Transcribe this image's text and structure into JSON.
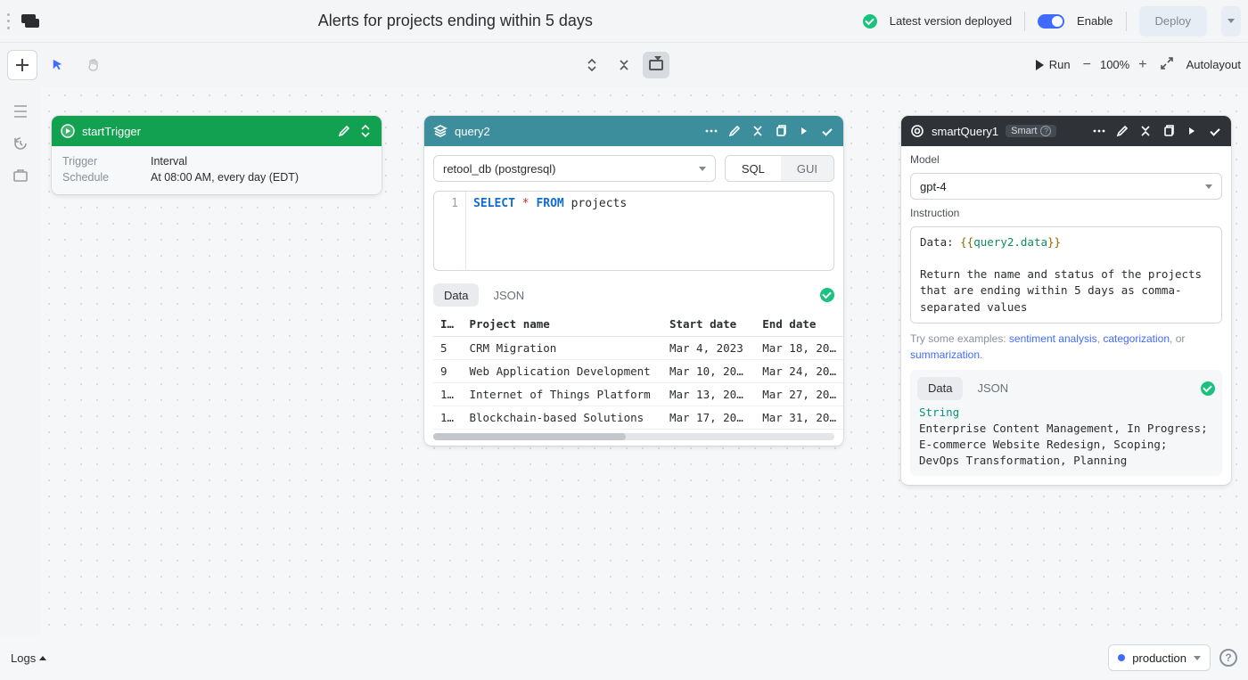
{
  "header": {
    "title": "Alerts for projects ending within 5 days",
    "deployed_status": "Latest version deployed",
    "enable_label": "Enable",
    "deploy_label": "Deploy"
  },
  "toolbar": {
    "run_label": "Run",
    "zoom": "100%",
    "autolayout_label": "Autolayout"
  },
  "nodes": {
    "trigger": {
      "name": "startTrigger",
      "rows": {
        "trigger_label": "Trigger",
        "trigger_value": "Interval",
        "schedule_label": "Schedule",
        "schedule_value": "At 08:00 AM, every day (EDT)"
      }
    },
    "query": {
      "name": "query2",
      "connection": "retool_db (postgresql)",
      "mode": {
        "sql": "SQL",
        "gui": "GUI"
      },
      "code_line_no": "1",
      "code": {
        "select": "SELECT",
        "star": "*",
        "from": "FROM",
        "table": "projects"
      },
      "tabs": {
        "data": "Data",
        "json": "JSON"
      },
      "columns": {
        "id": "I…",
        "name": "Project name",
        "start": "Start date",
        "end": "End date"
      },
      "rows": [
        {
          "id": "5",
          "name": "CRM Migration",
          "start": "Mar 4, 2023",
          "end": "Mar 18, 20…"
        },
        {
          "id": "9",
          "name": "Web Application Development",
          "start": "Mar 10, 20…",
          "end": "Mar 24, 20…"
        },
        {
          "id": "1…",
          "name": "Internet of Things Platform",
          "start": "Mar 13, 20…",
          "end": "Mar 27, 20…"
        },
        {
          "id": "1…",
          "name": "Blockchain-based Solutions",
          "start": "Mar 17, 20…",
          "end": "Mar 31, 20…"
        }
      ]
    },
    "ai": {
      "name": "smartQuery1",
      "smart_label": "Smart",
      "model_label": "Model",
      "model_value": "gpt-4",
      "instruction_label": "Instruction",
      "instruction": {
        "prefix": "Data: ",
        "open": "{{",
        "expr": "query2.data",
        "close": "}}",
        "body": "Return the name and status of the projects that are ending within 5 days as comma-separated values"
      },
      "examples_prefix": "Try some examples: ",
      "examples_links": {
        "a": "sentiment analysis",
        "b": "categorization",
        "c": "summarization"
      },
      "examples_or": ", or ",
      "tabs": {
        "data": "Data",
        "json": "JSON"
      },
      "result_type": "String",
      "result_text": "Enterprise Content Management, In Progress; E-commerce Website Redesign, Scoping; DevOps Transformation, Planning"
    }
  },
  "bottom": {
    "logs_label": "Logs",
    "env": "production"
  }
}
